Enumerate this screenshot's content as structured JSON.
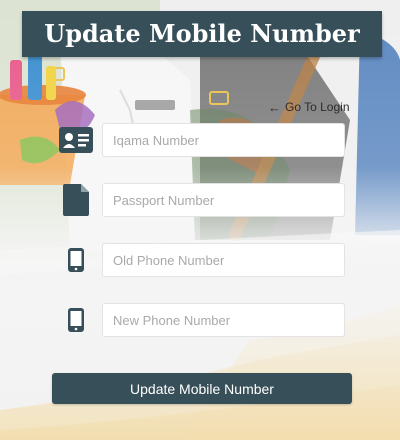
{
  "header": {
    "title": "Update Mobile Number"
  },
  "nav": {
    "go_to_login": "Go To Login"
  },
  "form": {
    "iqama": {
      "placeholder": "Iqama Number",
      "value": "",
      "icon": "id-card-icon"
    },
    "passport": {
      "placeholder": "Passport Number",
      "value": "",
      "icon": "document-icon"
    },
    "old_phone": {
      "placeholder": "Old Phone Number",
      "value": "",
      "icon": "mobile-phone-icon"
    },
    "new_phone": {
      "placeholder": "New Phone Number",
      "value": "",
      "icon": "mobile-phone-icon"
    },
    "submit_label": "Update Mobile Number"
  },
  "colors": {
    "primary": "#374f58",
    "accent_yellow": "#f3c24f",
    "icon": "#374f58"
  }
}
